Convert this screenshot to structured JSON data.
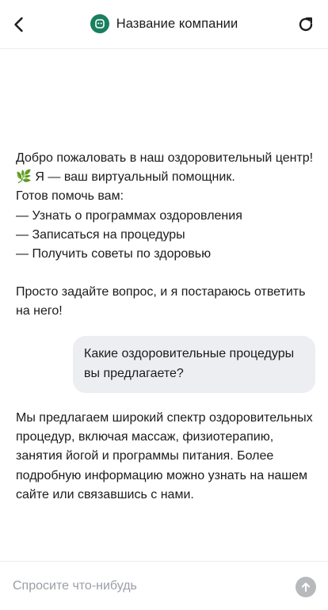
{
  "header": {
    "title": "Название компании",
    "back_icon": "chevron-left-icon",
    "logo_icon": "chat-bot-icon",
    "refresh_icon": "refresh-icon",
    "brand_color": "#1a7f5e"
  },
  "messages": [
    {
      "role": "assistant",
      "paragraphs": [
        "Добро пожаловать в наш оздоровительный центр! 🌿 Я — ваш виртуальный помощник.\nГотов помочь вам:\n— Узнать о программах оздоровления\n— Записаться на процедуры\n— Получить советы по здоровью",
        "Просто задайте вопрос, и я постараюсь ответить на него!"
      ]
    },
    {
      "role": "user",
      "text": "Какие оздоровительные процедуры вы предлагаете?"
    },
    {
      "role": "assistant",
      "paragraphs": [
        "Мы предлагаем широкий спектр оздоровительных процедур, включая массаж, физиотерапию, занятия йогой и программы питания. Более подробную информацию можно узнать на нашем сайте или связавшись с нами."
      ]
    }
  ],
  "composer": {
    "placeholder": "Спросите что-нибудь",
    "value": "",
    "send_icon": "arrow-up-icon"
  }
}
